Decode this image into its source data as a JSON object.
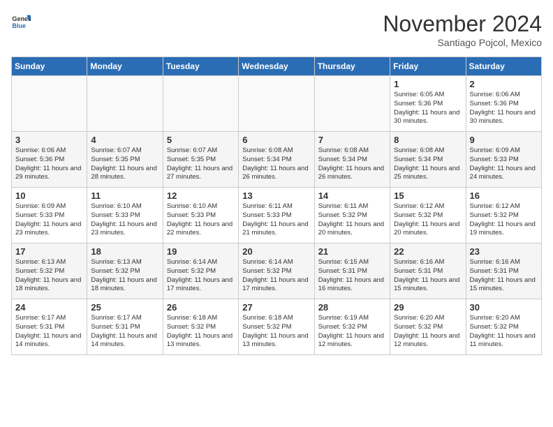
{
  "logo": {
    "line1": "General",
    "line2": "Blue"
  },
  "title": "November 2024",
  "location": "Santiago Pojcol, Mexico",
  "days_of_week": [
    "Sunday",
    "Monday",
    "Tuesday",
    "Wednesday",
    "Thursday",
    "Friday",
    "Saturday"
  ],
  "weeks": [
    [
      {
        "num": "",
        "info": "",
        "empty": true
      },
      {
        "num": "",
        "info": "",
        "empty": true
      },
      {
        "num": "",
        "info": "",
        "empty": true
      },
      {
        "num": "",
        "info": "",
        "empty": true
      },
      {
        "num": "",
        "info": "",
        "empty": true
      },
      {
        "num": "1",
        "info": "Sunrise: 6:05 AM\nSunset: 5:36 PM\nDaylight: 11 hours and 30 minutes."
      },
      {
        "num": "2",
        "info": "Sunrise: 6:06 AM\nSunset: 5:36 PM\nDaylight: 11 hours and 30 minutes."
      }
    ],
    [
      {
        "num": "3",
        "info": "Sunrise: 6:06 AM\nSunset: 5:36 PM\nDaylight: 11 hours and 29 minutes."
      },
      {
        "num": "4",
        "info": "Sunrise: 6:07 AM\nSunset: 5:35 PM\nDaylight: 11 hours and 28 minutes."
      },
      {
        "num": "5",
        "info": "Sunrise: 6:07 AM\nSunset: 5:35 PM\nDaylight: 11 hours and 27 minutes."
      },
      {
        "num": "6",
        "info": "Sunrise: 6:08 AM\nSunset: 5:34 PM\nDaylight: 11 hours and 26 minutes."
      },
      {
        "num": "7",
        "info": "Sunrise: 6:08 AM\nSunset: 5:34 PM\nDaylight: 11 hours and 26 minutes."
      },
      {
        "num": "8",
        "info": "Sunrise: 6:08 AM\nSunset: 5:34 PM\nDaylight: 11 hours and 25 minutes."
      },
      {
        "num": "9",
        "info": "Sunrise: 6:09 AM\nSunset: 5:33 PM\nDaylight: 11 hours and 24 minutes."
      }
    ],
    [
      {
        "num": "10",
        "info": "Sunrise: 6:09 AM\nSunset: 5:33 PM\nDaylight: 11 hours and 23 minutes."
      },
      {
        "num": "11",
        "info": "Sunrise: 6:10 AM\nSunset: 5:33 PM\nDaylight: 11 hours and 23 minutes."
      },
      {
        "num": "12",
        "info": "Sunrise: 6:10 AM\nSunset: 5:33 PM\nDaylight: 11 hours and 22 minutes."
      },
      {
        "num": "13",
        "info": "Sunrise: 6:11 AM\nSunset: 5:33 PM\nDaylight: 11 hours and 21 minutes."
      },
      {
        "num": "14",
        "info": "Sunrise: 6:11 AM\nSunset: 5:32 PM\nDaylight: 11 hours and 20 minutes."
      },
      {
        "num": "15",
        "info": "Sunrise: 6:12 AM\nSunset: 5:32 PM\nDaylight: 11 hours and 20 minutes."
      },
      {
        "num": "16",
        "info": "Sunrise: 6:12 AM\nSunset: 5:32 PM\nDaylight: 11 hours and 19 minutes."
      }
    ],
    [
      {
        "num": "17",
        "info": "Sunrise: 6:13 AM\nSunset: 5:32 PM\nDaylight: 11 hours and 18 minutes."
      },
      {
        "num": "18",
        "info": "Sunrise: 6:13 AM\nSunset: 5:32 PM\nDaylight: 11 hours and 18 minutes."
      },
      {
        "num": "19",
        "info": "Sunrise: 6:14 AM\nSunset: 5:32 PM\nDaylight: 11 hours and 17 minutes."
      },
      {
        "num": "20",
        "info": "Sunrise: 6:14 AM\nSunset: 5:32 PM\nDaylight: 11 hours and 17 minutes."
      },
      {
        "num": "21",
        "info": "Sunrise: 6:15 AM\nSunset: 5:31 PM\nDaylight: 11 hours and 16 minutes."
      },
      {
        "num": "22",
        "info": "Sunrise: 6:16 AM\nSunset: 5:31 PM\nDaylight: 11 hours and 15 minutes."
      },
      {
        "num": "23",
        "info": "Sunrise: 6:16 AM\nSunset: 5:31 PM\nDaylight: 11 hours and 15 minutes."
      }
    ],
    [
      {
        "num": "24",
        "info": "Sunrise: 6:17 AM\nSunset: 5:31 PM\nDaylight: 11 hours and 14 minutes."
      },
      {
        "num": "25",
        "info": "Sunrise: 6:17 AM\nSunset: 5:31 PM\nDaylight: 11 hours and 14 minutes."
      },
      {
        "num": "26",
        "info": "Sunrise: 6:18 AM\nSunset: 5:32 PM\nDaylight: 11 hours and 13 minutes."
      },
      {
        "num": "27",
        "info": "Sunrise: 6:18 AM\nSunset: 5:32 PM\nDaylight: 11 hours and 13 minutes."
      },
      {
        "num": "28",
        "info": "Sunrise: 6:19 AM\nSunset: 5:32 PM\nDaylight: 11 hours and 12 minutes."
      },
      {
        "num": "29",
        "info": "Sunrise: 6:20 AM\nSunset: 5:32 PM\nDaylight: 11 hours and 12 minutes."
      },
      {
        "num": "30",
        "info": "Sunrise: 6:20 AM\nSunset: 5:32 PM\nDaylight: 11 hours and 11 minutes."
      }
    ]
  ]
}
